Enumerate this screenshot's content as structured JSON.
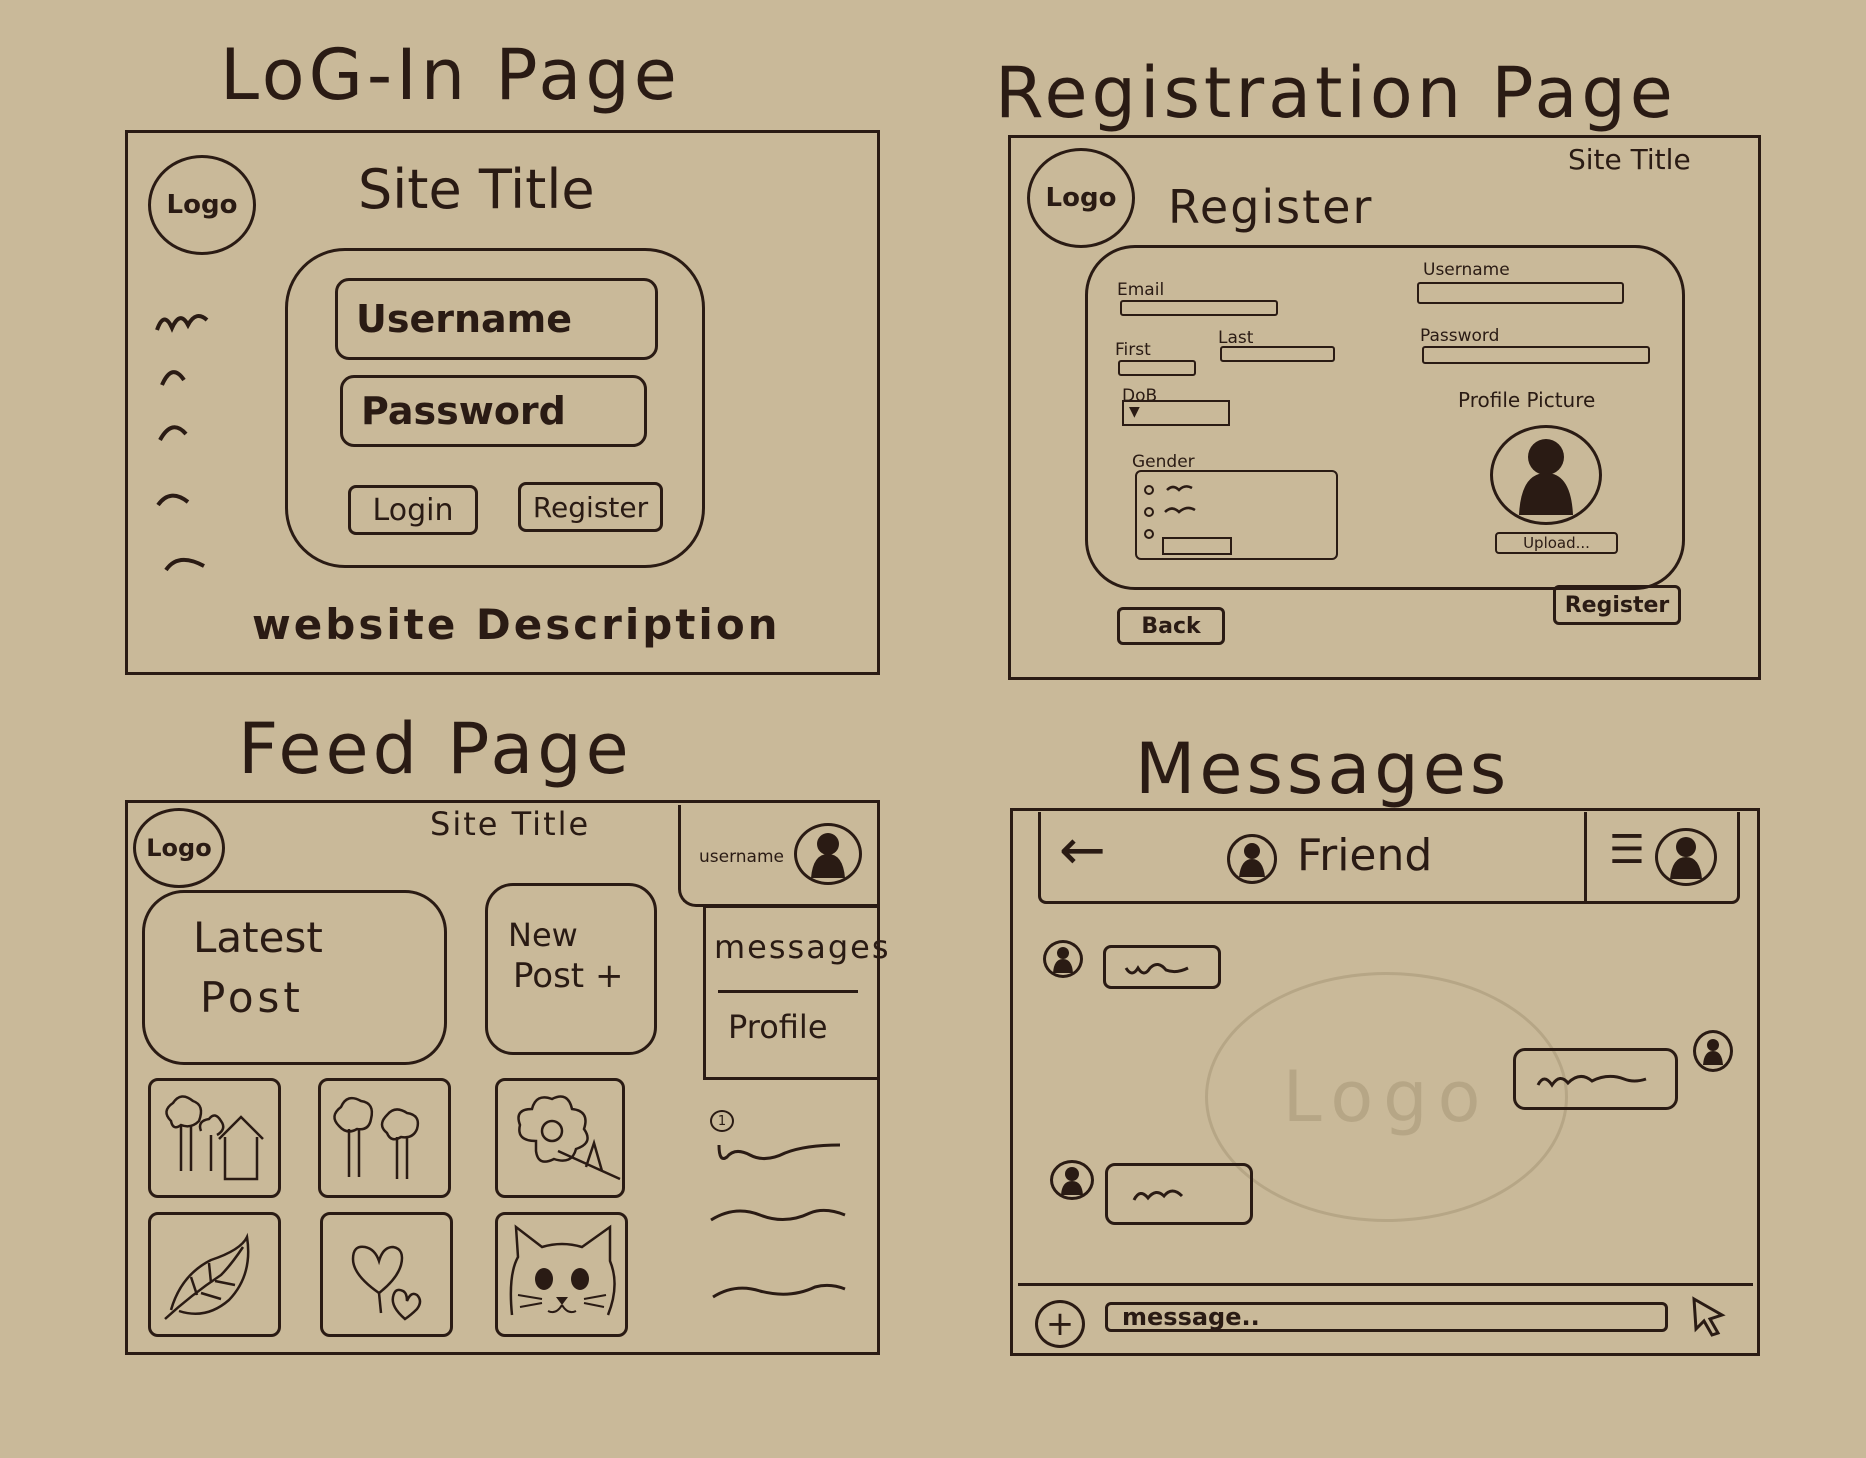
{
  "colors": {
    "paper": "#c9b999",
    "ink": "#2a1b14",
    "faint": "#b6a686"
  },
  "login": {
    "heading": "LoG-In Page",
    "logo": "Logo",
    "site_title": "Site Title",
    "username": "Username",
    "password": "Password",
    "login_btn": "Login",
    "register_btn": "Register",
    "description": "website Description"
  },
  "registration": {
    "heading": "Registration Page",
    "logo": "Logo",
    "site_title": "Site Title",
    "register_title": "Register",
    "email": "Email",
    "first": "First",
    "last": "Last",
    "dob": "DoB",
    "gender": "Gender",
    "username": "Username",
    "password": "Password",
    "profile_picture": "Profile Picture",
    "upload": "Upload...",
    "back_btn": "Back",
    "register_btn": "Register"
  },
  "feed": {
    "heading": "Feed Page",
    "logo": "Logo",
    "site_title": "Site Title",
    "username": "username",
    "latest_line1": "Latest",
    "latest_line2": "Post",
    "new_line1": "New",
    "new_line2": "Post +",
    "messages": "messages",
    "profile": "Profile",
    "notif_badge": "1"
  },
  "messages": {
    "heading": "Messages",
    "back_arrow": "←",
    "friend": "Friend",
    "watermark": "Logo",
    "message_placeholder": "message..",
    "add_btn": "+"
  }
}
